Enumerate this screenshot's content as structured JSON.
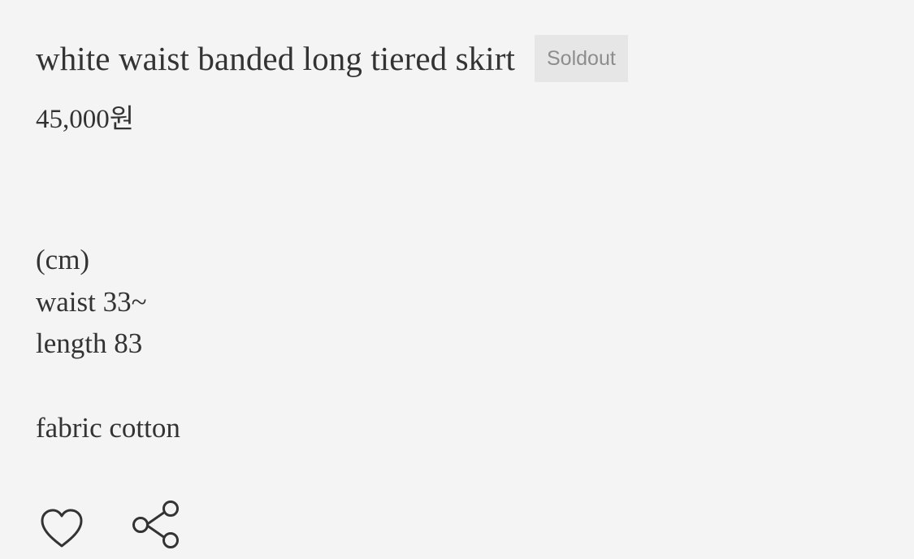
{
  "product": {
    "title": "white waist banded long tiered skirt",
    "status_badge": "Soldout",
    "price": "45,000원"
  },
  "details": {
    "unit": "(cm)",
    "waist": "waist 33~",
    "length": "length 83",
    "fabric": "fabric cotton"
  },
  "actions": {
    "like_icon": "heart-icon",
    "share_icon": "share-icon"
  },
  "colors": {
    "background": "#f4f4f4",
    "text": "#333333",
    "badge_background": "#e6e6e6",
    "badge_text": "#8d8d8d"
  }
}
